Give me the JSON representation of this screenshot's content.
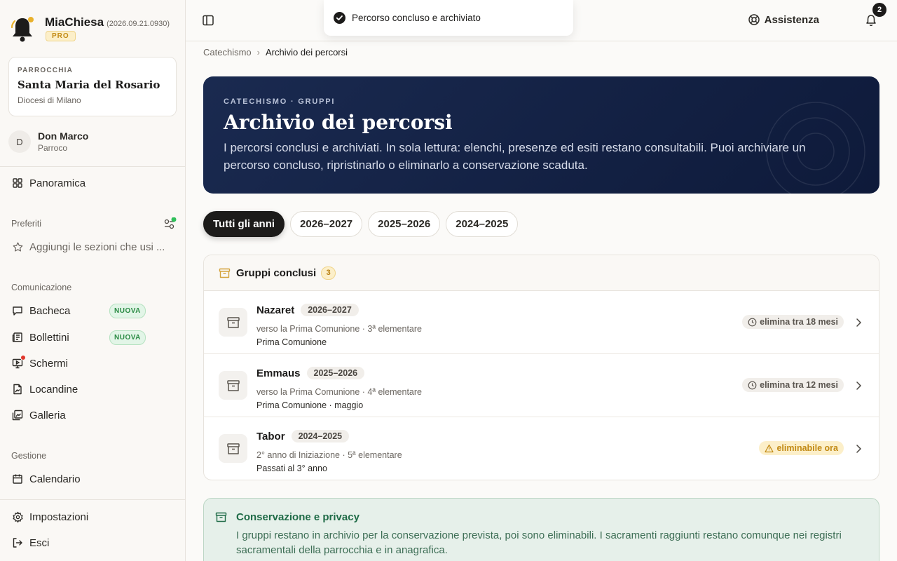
{
  "app": {
    "name": "MiaChiesa",
    "version": "(2026.09.21.0930)",
    "plan_badge": "PRO"
  },
  "parish": {
    "label": "PARROCCHIA",
    "name": "Santa Maria del Rosario",
    "diocese": "Diocesi di Milano"
  },
  "user": {
    "initial": "D",
    "name": "Don Marco",
    "role": "Parroco"
  },
  "nav": {
    "overview": "Panoramica",
    "favorites_label": "Preferiti",
    "favorites_add": "Aggiungi le sezioni che usi ...",
    "communication_label": "Comunicazione",
    "communication": [
      {
        "label": "Bacheca",
        "badge": "NUOVA"
      },
      {
        "label": "Bollettini",
        "badge": "NUOVA"
      },
      {
        "label": "Schermi",
        "badge": ""
      },
      {
        "label": "Locandine",
        "badge": ""
      },
      {
        "label": "Galleria",
        "badge": ""
      }
    ],
    "management_label": "Gestione",
    "calendar": "Calendario",
    "settings": "Impostazioni",
    "logout": "Esci"
  },
  "topbar": {
    "help": "Assistenza",
    "notifications": "2"
  },
  "toast": {
    "message": "Percorso concluso e archiviato"
  },
  "breadcrumb": {
    "parent": "Catechismo",
    "current": "Archivio dei percorsi"
  },
  "hero": {
    "eyebrow": "CATECHISMO · GRUPPI",
    "title": "Archivio dei percorsi",
    "description": "I percorsi conclusi e archiviati. In sola lettura: elenchi, presenze ed esiti restano consultabili. Puoi archiviare un percorso concluso, ripristinarlo o eliminarlo a conservazione scaduta."
  },
  "year_filters": [
    "Tutti gli anni",
    "2026–2027",
    "2025–2026",
    "2024–2025"
  ],
  "groups": {
    "title": "Gruppi conclusi",
    "count": "3",
    "rows": [
      {
        "name": "Nazaret",
        "year": "2026–2027",
        "path": "verso la Prima Comunione · 3ª elementare",
        "sacrament": "Prima Comunione",
        "retention": "elimina tra 18 mesi",
        "status": "grey"
      },
      {
        "name": "Emmaus",
        "year": "2025–2026",
        "path": "verso la Prima Comunione · 4ª elementare",
        "sacrament": "Prima Comunione · maggio",
        "retention": "elimina tra 12 mesi",
        "status": "grey"
      },
      {
        "name": "Tabor",
        "year": "2024–2025",
        "path": "2° anno di Iniziazione · 5ª elementare",
        "sacrament": "Passati al 3° anno",
        "retention": "eliminabile ora",
        "status": "amber"
      }
    ]
  },
  "privacy": {
    "title": "Conservazione e privacy",
    "text": "I gruppi restano in archivio per la conservazione prevista, poi sono eliminabili. I sacramenti raggiunti restano comunque nei registri sacramentali della parrocchia e in anagrafica."
  },
  "colors": {
    "navy": "#0e1a3a",
    "accent_green": "#2a8a43",
    "amber": "#c28a14",
    "red_dot": "#e0362c"
  }
}
